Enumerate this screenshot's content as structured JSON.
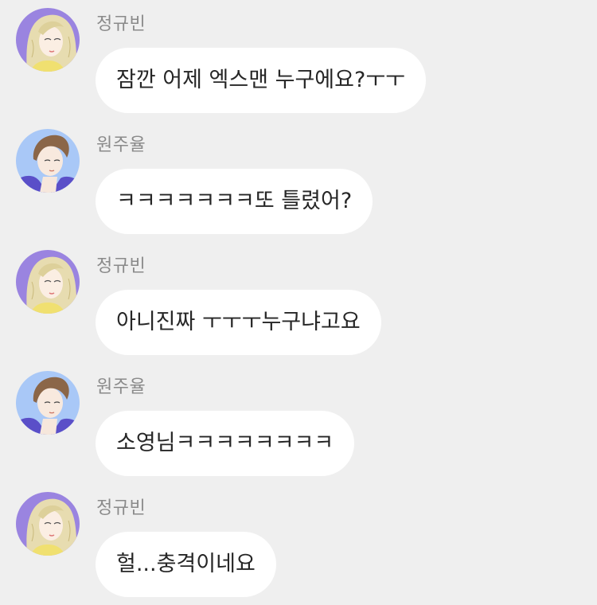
{
  "colors": {
    "background": "#efefef",
    "bubble": "#ffffff",
    "sender_text": "#8a8a8a",
    "message_text": "#262626"
  },
  "messages": [
    {
      "sender": "정규빈",
      "avatar": "girl-avatar",
      "text": "잠깐 어제 엑스맨 누구에요?ㅜㅜ"
    },
    {
      "sender": "원주율",
      "avatar": "boy-avatar",
      "text": "ㅋㅋㅋㅋㅋㅋㅋ또 틀렸어?"
    },
    {
      "sender": "정규빈",
      "avatar": "girl-avatar",
      "text": "아니진짜 ㅜㅜㅜ누구냐고요"
    },
    {
      "sender": "원주율",
      "avatar": "boy-avatar",
      "text": "소영님ㅋㅋㅋㅋㅋㅋㅋㅋ"
    },
    {
      "sender": "정규빈",
      "avatar": "girl-avatar",
      "text": "헐...충격이네요"
    }
  ]
}
